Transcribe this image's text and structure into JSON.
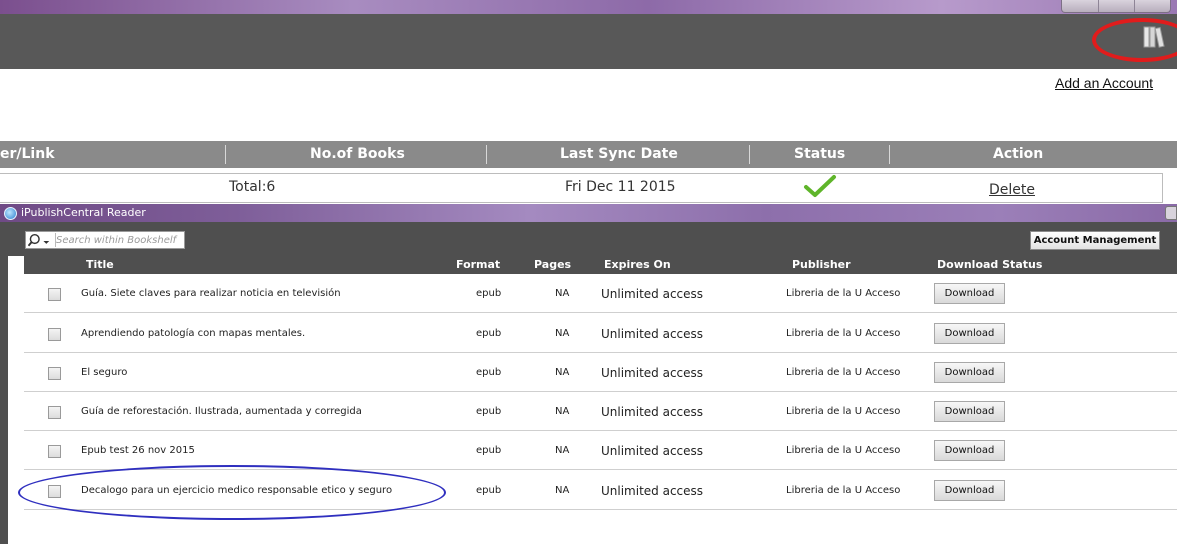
{
  "account_window": {
    "add_account_label": "Add an Account",
    "columns": [
      "er/Link",
      "No.of Books",
      "Last Sync Date",
      "Status",
      "Action"
    ],
    "row": {
      "total": "Total:6",
      "last_sync": "Fri Dec 11 2015",
      "status_icon": "checkmark-icon",
      "action": "Delete"
    }
  },
  "reader_window": {
    "title": "iPublishCentral Reader",
    "search_placeholder": "Search within Bookshelf",
    "account_management_label": "Account Management",
    "columns": [
      "Title",
      "Format",
      "Pages",
      "Expires On",
      "Publisher",
      "Download Status"
    ],
    "books": [
      {
        "title": "Guía. Siete claves para realizar noticia en televisión",
        "format": "epub",
        "pages": "NA",
        "expires": "Unlimited access",
        "publisher": "Libreria de la U Acceso",
        "action": "Download"
      },
      {
        "title": "Aprendiendo patología con mapas mentales.",
        "format": "epub",
        "pages": "NA",
        "expires": "Unlimited access",
        "publisher": "Libreria de la U Acceso",
        "action": "Download"
      },
      {
        "title": "El seguro",
        "format": "epub",
        "pages": "NA",
        "expires": "Unlimited access",
        "publisher": "Libreria de la U Acceso",
        "action": "Download"
      },
      {
        "title": "Guía de reforestación. Ilustrada, aumentada y corregida",
        "format": "epub",
        "pages": "NA",
        "expires": "Unlimited access",
        "publisher": "Libreria de la U Acceso",
        "action": "Download"
      },
      {
        "title": "Epub test 26 nov 2015",
        "format": "epub",
        "pages": "NA",
        "expires": "Unlimited access",
        "publisher": "Libreria de la U Acceso",
        "action": "Download"
      },
      {
        "title": "Decalogo para un ejercicio medico responsable etico y seguro",
        "format": "epub",
        "pages": "NA",
        "expires": "Unlimited access",
        "publisher": "Libreria de la U Acceso",
        "action": "Download"
      }
    ]
  },
  "annotations": {
    "red_circle_color": "#e11c1c",
    "blue_circle_color": "#2f2fbf"
  }
}
